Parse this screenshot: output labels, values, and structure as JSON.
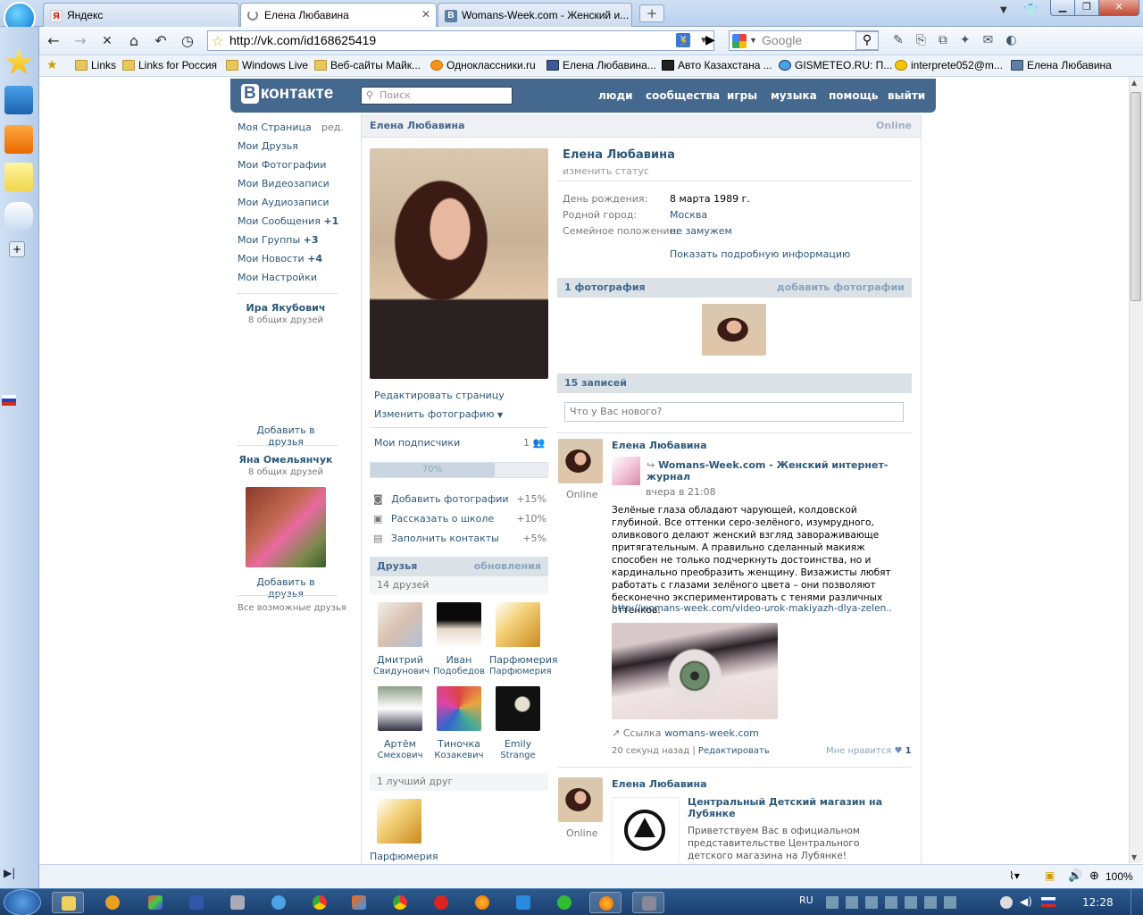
{
  "browser": {
    "tabs": [
      {
        "label": "Яндекс",
        "favicon": "Я"
      },
      {
        "label": "Елена Любавина",
        "favicon": "spinner"
      },
      {
        "label": "Womans-Week.com - Женский и...",
        "favicon": "B"
      }
    ],
    "new_tab": "+",
    "url": "http://vk.com/id168625419",
    "search_placeholder": "Google",
    "bookmarks": [
      "Links",
      "Links for Россия",
      "Windows Live",
      "Веб-сайты Майк...",
      "Одноклассники.ru",
      "Елена Любавина...",
      "Авто Казахстана ...",
      "GISMETEO.RU: П...",
      "interprete052@m...",
      "Елена Любавина"
    ],
    "zoom": "100%"
  },
  "taskbar": {
    "lang": "RU",
    "time": "12:28"
  },
  "vk": {
    "logo": "контакте",
    "logo_b": "В",
    "search_placeholder": "Поиск",
    "menu": [
      "люди",
      "сообщества",
      "игры",
      "музыка",
      "помощь",
      "выйти"
    ],
    "left_menu": [
      {
        "label": "Моя Страница",
        "extra": "ред."
      },
      {
        "label": "Мои Друзья",
        "extra": ""
      },
      {
        "label": "Мои Фотографии",
        "extra": ""
      },
      {
        "label": "Мои Видеозаписи",
        "extra": ""
      },
      {
        "label": "Мои Аудиозаписи",
        "extra": ""
      },
      {
        "label": "Мои Сообщения",
        "extra": "+1"
      },
      {
        "label": "Мои Группы",
        "extra": "+3"
      },
      {
        "label": "Мои Новости",
        "extra": "+4"
      },
      {
        "label": "Мои Настройки",
        "extra": ""
      }
    ],
    "suggest1": {
      "name": "Ира Якубович",
      "common": "8 общих друзей",
      "add": "Добавить в друзья"
    },
    "suggest2": {
      "name": "Яна Омельянчук",
      "common": "8 общих друзей",
      "add": "Добавить в друзья"
    },
    "all_friends": "Все возможные друзья",
    "profile_name_header": "Елена Любавина",
    "online": "Online",
    "edit_page": "Редактировать страницу",
    "change_photo": "Изменить фотографию",
    "subscribers": "Мои подписчики",
    "subscribers_count": "1",
    "progress_label": "70%",
    "progress_value": 0.7,
    "tasks": [
      {
        "label": "Добавить фотографии",
        "pct": "+15%"
      },
      {
        "label": "Рассказать о школе",
        "pct": "+10%"
      },
      {
        "label": "Заполнить контакты",
        "pct": "+5%"
      }
    ],
    "friends_title": "Друзья",
    "friends_updates": "обновления",
    "friends_count": "14 друзей",
    "friends": [
      {
        "first": "Дмитрий",
        "last": "Свидунович"
      },
      {
        "first": "Иван",
        "last": "Подобедов"
      },
      {
        "first": "Парфюмерия",
        "last": "Парфюмерия"
      },
      {
        "first": "Артём",
        "last": "Смехович"
      },
      {
        "first": "Тиночка",
        "last": "Козакевич"
      },
      {
        "first": "Emily",
        "last": "Strange"
      }
    ],
    "best_friend_title": "1 лучший друг",
    "best_friend": "Парфюмерия",
    "name": "Елена Любавина",
    "change_status": "изменить статус",
    "info": [
      {
        "k": "День рождения:",
        "v": "8 марта 1989 г."
      },
      {
        "k": "Родной город:",
        "v": "Москва"
      },
      {
        "k": "Семейное положение:",
        "v": "не замужем"
      }
    ],
    "show_more": "Показать подробную информацию",
    "photos_title": "1 фотография",
    "add_photos": "добавить фотографии",
    "wall_title": "15 записей",
    "wall_placeholder": "Что у Вас нового?",
    "post1": {
      "author": "Елена Любавина",
      "online": "Online",
      "source": "Womans-Week.com - Женский интернет-журнал",
      "date": "вчера в 21:08",
      "text": "Зелёные глаза обладают чарующей, колдовской глубиной. Все оттенки серо-зелёного, изумрудного, оливкового делают женский взгляд завораживающе притягательным. А правильно сделанный макияж способен не только подчеркнуть достоинства, но и кардинально преобразить женщину. Визажисты любят работать с глазами зелёного цвета – они позволяют бесконечно экспериментировать с тенями различных оттенков.",
      "link": "http://womans-week.com/video-urok-makiyazh-dlya-zelen..",
      "link_label": "Ссылка",
      "link_site": "womans-week.com",
      "time": "20 секунд назад",
      "edit": "Редактировать",
      "like_label": "Мне нравится",
      "likes": "1"
    },
    "post2": {
      "author": "Елена Любавина",
      "online": "Online",
      "title": "Центральный Детский магазин на Лубянке",
      "text": "Приветствуем Вас в официальном представительстве Центрального детского магазина на Лубянке! Детский"
    }
  }
}
